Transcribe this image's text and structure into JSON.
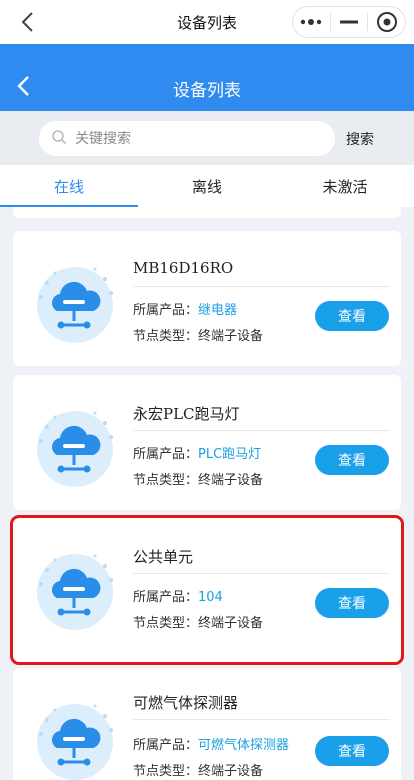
{
  "topbar": {
    "title": "设备列表"
  },
  "header": {
    "title": "设备列表"
  },
  "search": {
    "placeholder": "关键搜索",
    "button": "搜索"
  },
  "tabs": [
    {
      "label": "在线"
    },
    {
      "label": "离线"
    },
    {
      "label": "未激活"
    }
  ],
  "labels": {
    "product": "所属产品：",
    "node_type": "节点类型：",
    "view": "查看"
  },
  "devices": [
    {
      "name": "MB16D16RO",
      "product": "继电器",
      "node_type": "终端子设备"
    },
    {
      "name": "永宏PLC跑马灯",
      "product": "PLC跑马灯",
      "node_type": "终端子设备"
    },
    {
      "name": "公共单元",
      "product": "104",
      "node_type": "终端子设备"
    },
    {
      "name": "可燃气体探测器",
      "product": "可燃气体探测器",
      "node_type": "终端子设备"
    }
  ],
  "colors": {
    "accent": "#2f8bf0",
    "button": "#1a9fea",
    "link": "#1a9fe0",
    "highlight": "#e01818"
  },
  "icons": {
    "back": "chevron-left-icon",
    "more": "more-dots-icon",
    "minimize": "minus-icon",
    "close": "target-icon",
    "search": "search-icon",
    "device": "cloud-network-icon"
  }
}
